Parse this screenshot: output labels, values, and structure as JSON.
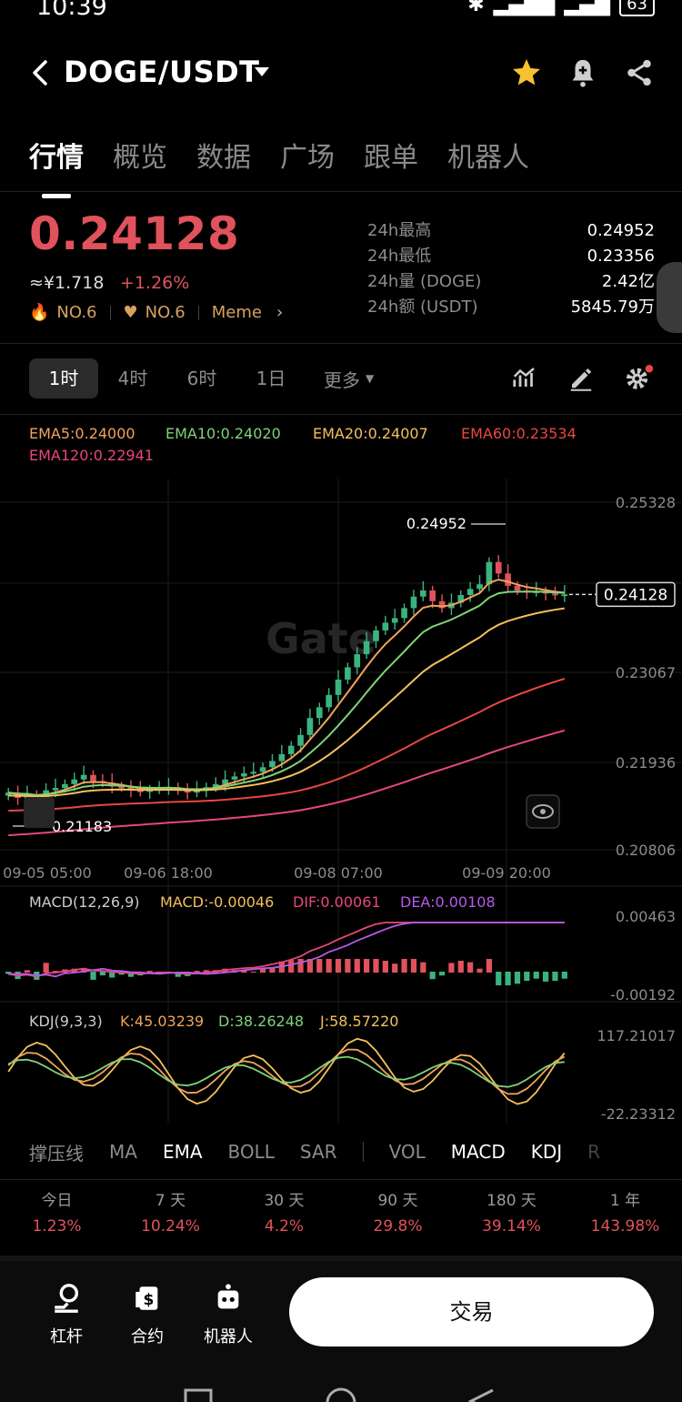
{
  "status_bar": {
    "time": "10:39",
    "battery": "63"
  },
  "header": {
    "title": "DOGE/USDT"
  },
  "tabs": [
    {
      "label": "行情",
      "active": true
    },
    {
      "label": "概览"
    },
    {
      "label": "数据"
    },
    {
      "label": "广场"
    },
    {
      "label": "跟单"
    },
    {
      "label": "机器人"
    }
  ],
  "ticker": {
    "price": "0.24128",
    "cny": "≈¥1.718",
    "change": "+1.26%",
    "rank1": "NO.6",
    "rank2": "NO.6",
    "tag": "Meme",
    "stats": [
      {
        "label": "24h最高",
        "value": "0.24952"
      },
      {
        "label": "24h最低",
        "value": "0.23356"
      },
      {
        "label": "24h量 (DOGE)",
        "value": "2.42亿"
      },
      {
        "label": "24h额 (USDT)",
        "value": "5845.79万"
      }
    ]
  },
  "timeframes": {
    "items": [
      "1时",
      "4时",
      "6时",
      "1日"
    ],
    "active": 0,
    "more": "更多"
  },
  "ema_legend": {
    "ema5": "EMA5:0.24000",
    "ema10": "EMA10:0.24020",
    "ema20": "EMA20:0.24007",
    "ema60": "EMA60:0.23534",
    "ema120": "EMA120:0.22941"
  },
  "chart_data": {
    "type": "candlestick",
    "price_axis": [
      "0.25328",
      "0.23067",
      "0.21936",
      "0.20806"
    ],
    "ylim": [
      0.20806,
      0.25328
    ],
    "time_axis": [
      "09-05 05:00",
      "09-06 18:00",
      "09-08 07:00",
      "09-09 20:00"
    ],
    "last_price_tag": "0.24128",
    "high_label": "0.24952",
    "low_label": "0.21183",
    "watermark": "Gate",
    "close_series": [
      0.2155,
      0.2148,
      0.2152,
      0.2144,
      0.2158,
      0.2161,
      0.2166,
      0.2172,
      0.2178,
      0.217,
      0.2168,
      0.2163,
      0.2162,
      0.2158,
      0.2156,
      0.2159,
      0.2161,
      0.2162,
      0.2158,
      0.2155,
      0.2158,
      0.2162,
      0.2166,
      0.2172,
      0.2176,
      0.218,
      0.2182,
      0.2188,
      0.2196,
      0.2205,
      0.2216,
      0.223,
      0.2252,
      0.2266,
      0.2282,
      0.2302,
      0.2318,
      0.2335,
      0.2352,
      0.2366,
      0.2376,
      0.2382,
      0.2395,
      0.241,
      0.2418,
      0.2404,
      0.2395,
      0.2402,
      0.2412,
      0.242,
      0.2426,
      0.2455,
      0.244,
      0.2424,
      0.2418,
      0.2416,
      0.2417,
      0.2414,
      0.2412,
      0.2413
    ]
  },
  "macd": {
    "title": "MACD(12,26,9)",
    "macd": "MACD:-0.00046",
    "dif": "DIF:0.00061",
    "dea": "DEA:0.00108",
    "axis_top": "0.00463",
    "axis_bottom": "-0.00192"
  },
  "kdj": {
    "title": "KDJ(9,3,3)",
    "k": "K:45.03239",
    "d": "D:38.26248",
    "j": "J:58.57220",
    "axis_top": "117.21017",
    "axis_bottom": "-22.23312"
  },
  "indicator_tabs": {
    "main": [
      "撑压线",
      "MA",
      "EMA",
      "BOLL",
      "SAR"
    ],
    "sub": [
      "VOL",
      "MACD",
      "KDJ",
      "R"
    ]
  },
  "performance": [
    {
      "label": "今日",
      "value": "1.23%"
    },
    {
      "label": "7 天",
      "value": "10.24%"
    },
    {
      "label": "30 天",
      "value": "4.2%"
    },
    {
      "label": "90 天",
      "value": "29.8%"
    },
    {
      "label": "180 天",
      "value": "39.14%"
    },
    {
      "label": "1 年",
      "value": "143.98%"
    }
  ],
  "bottom_bar": {
    "leverage": "杠杆",
    "contract": "合约",
    "bot": "机器人",
    "trade": "交易"
  },
  "colors": {
    "up": "#3bb37e",
    "down": "#e0525c",
    "ema5": "#f0a35a",
    "ema10": "#7fd37a",
    "ema20": "#f2c15a",
    "ema60": "#e8473f",
    "ema120": "#e8477a"
  }
}
